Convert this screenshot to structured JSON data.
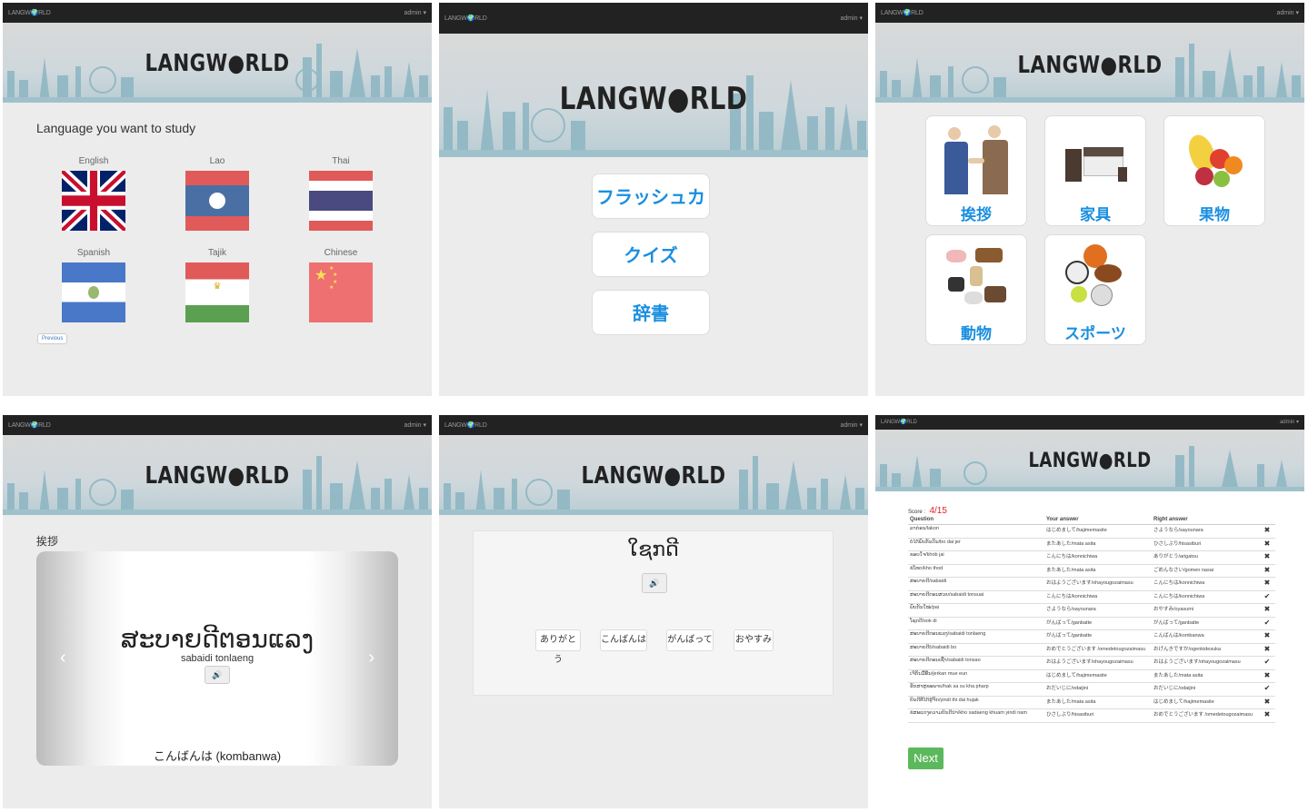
{
  "app": {
    "brand": "LANGW🌍RLD",
    "logo_text": "LANGW●RLD",
    "user_menu": "admin ▾"
  },
  "colors": {
    "accent_blue": "#1a8fe0",
    "score_red": "#e02020",
    "next_green": "#5cb85c",
    "navbar": "#222222"
  },
  "p1": {
    "heading": "Language you want to study",
    "languages": [
      {
        "label": "English",
        "flag": "uk-flag"
      },
      {
        "label": "Lao",
        "flag": "lao-flag"
      },
      {
        "label": "Thai",
        "flag": "thai-flag"
      },
      {
        "label": "Spanish",
        "flag": "el-salvador-flag"
      },
      {
        "label": "Tajik",
        "flag": "tajik-flag"
      },
      {
        "label": "Chinese",
        "flag": "china-flag"
      }
    ],
    "previous_label": "Previous"
  },
  "p2": {
    "buttons": [
      "フラッシュカード",
      "クイズ",
      "辞書"
    ]
  },
  "p3": {
    "categories": [
      "挨拶",
      "家具",
      "果物",
      "動物",
      "スポーツ"
    ]
  },
  "p4": {
    "heading": "挨拶",
    "lao_word": "ສະບາຍດີຕອນແລງ",
    "romanization": "sabaidi tonlaeng",
    "translation": "こんばんは (kombanwa)",
    "prev_arrow": "‹",
    "next_arrow": "›"
  },
  "p5": {
    "word": "ໃຊກດີ",
    "options": [
      "ありがとう",
      "こんばんは",
      "がんばって",
      "おやすみ"
    ]
  },
  "p6": {
    "score_label": "Score :",
    "score_value": "4/15",
    "headers": [
      "Question",
      "Your answer",
      "Right answer"
    ],
    "rows": [
      [
        "ລາກ່ອນ/lakon",
        "はじめまして/hajimemasite",
        "さようなら/sayounara",
        "✖"
      ],
      [
        "ບໍ່ໄດ້ພົບກັນດົນ/bo dai jer",
        "またあした/mata asita",
        "ひさしぶり/hisasiburi",
        "✖"
      ],
      [
        "ຂອບໃຈ/khob jai",
        "こんにちは/konnichiwa",
        "ありがとう/arigatou",
        "✖"
      ],
      [
        "ຂໍໂທດ/kho thod",
        "またあした/mata asita",
        "ごめんなさい/gomen nasai",
        "✖"
      ],
      [
        "ສະບາຍດີ/sabaidi",
        "おはようございます/ohayougozaimasu",
        "こんにちは/konnichiwa",
        "✖"
      ],
      [
        "ສະບາຍດີຕອນສວຍ/sabaidi tonsuai",
        "こんにちは/konnichiwa",
        "こんにちは/konnichiwa",
        "✔"
      ],
      [
        "ພົບກັນໃໝ່/pai",
        "さようなら/sayounara",
        "おやすみ/oyasumi",
        "✖"
      ],
      [
        "ໂຊກດີ/sok di",
        "がんばって/ganbatte",
        "がんばって/ganbatte",
        "✔"
      ],
      [
        "ສະບາຍດີຕອນແລງ/sabaidi tonlaeng",
        "がんばって/ganbatte",
        "こんばんは/kombanwa",
        "✖"
      ],
      [
        "ສະບາຍດີບໍ/sabaidi bo",
        "おめでとうございます /omedetougozaimasu",
        "おげんきですか/ogenkidesuka",
        "✖"
      ],
      [
        "ສະບາຍດີຕອນເຊົ້າ/sabaidi tonsao",
        "おはようございます/ohayougozaimasu",
        "おはようございます/ohayougozaimasu",
        "✔"
      ],
      [
        "ເຈີກັນມື້ອື່ນ/jerkan mue eun",
        "はじめまして/hajimemasite",
        "またあした/mata asita",
        "✖"
      ],
      [
        "ຮັກສາສຸຂະພາບ/hak sa su kha pharp",
        "おだいじに/odaijini",
        "おだいじに/odaijini",
        "✔"
      ],
      [
        "ຍິນດີທີ່ໄດ້ຮູ້ຈັກ/yindi thi dai hujak",
        "またあした/mata asita",
        "はじめまして/hajimemasite",
        "✖"
      ],
      [
        "ຂໍສະແດງຄວາມຍິນດີນຳ/kho sadaeng khuam yindi nam",
        "ひさしぶり/hisasiburi",
        "おめでとうございます /omedetougozaimasu",
        "✖"
      ]
    ],
    "next_label": "Next"
  }
}
